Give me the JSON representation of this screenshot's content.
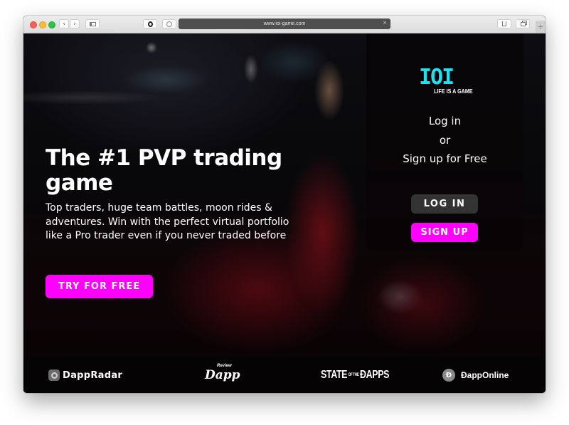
{
  "browser": {
    "url": "www.ioi-game.com",
    "back_icon": "‹",
    "forward_icon": "›",
    "new_tab_icon": "+",
    "close_url_icon": "×"
  },
  "panel": {
    "logo_mark": "IOI",
    "logo_tagline": "LIFE IS A GAME",
    "line1": "Log in",
    "line2": "or",
    "line3": "Sign up for Free",
    "login_label": "LOG IN",
    "signup_label": "SIGN UP"
  },
  "hero": {
    "title": "The #1 PVP trading game",
    "subtitle": "Top traders, huge team battles, moon rides & adventures. Win with the perfect virtual portfolio like a Pro trader even if you never traded before",
    "cta_label": "TRY FOR FREE"
  },
  "partners": [
    {
      "name": "DappRadar"
    },
    {
      "name": "Dapp",
      "badge": "Review"
    },
    {
      "name": "STATE OF THE DAPPS",
      "main1": "STATE",
      "small": "OF THE",
      "main2": "ĐAPPS"
    },
    {
      "name": "ĐappOnline",
      "icon_letter": "Đ"
    }
  ],
  "colors": {
    "accent": "#ff00ff",
    "logo": "#20e0ee",
    "login_button": "#333333"
  }
}
